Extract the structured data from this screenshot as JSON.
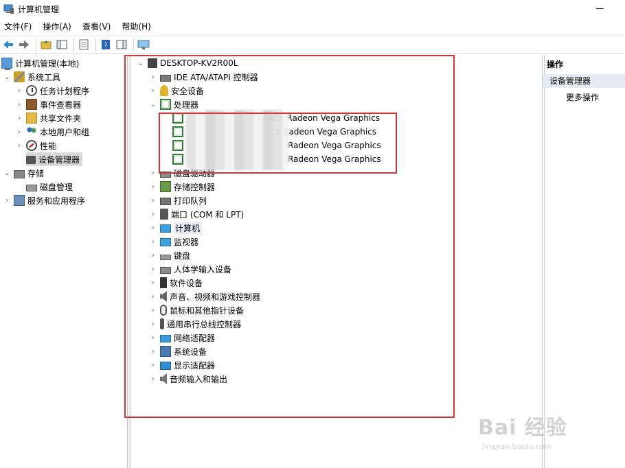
{
  "window": {
    "title": "计算机管理"
  },
  "menu": [
    "文件(F)",
    "操作(A)",
    "查看(V)",
    "帮助(H)"
  ],
  "toolbar": {
    "buttons": [
      "back-icon",
      "forward-icon",
      "up-folder-icon",
      "show-hide-tree-icon",
      "properties-icon",
      "help-icon",
      "action-pane-icon",
      "monitor-icon"
    ]
  },
  "left_tree": [
    {
      "label": "计算机管理(本地)",
      "icon": "computer-management-icon",
      "expander": ""
    },
    {
      "label": "系统工具",
      "icon": "tools-icon",
      "expander": "⌄"
    },
    {
      "label": "任务计划程序",
      "icon": "task-scheduler-icon",
      "expander": "›"
    },
    {
      "label": "事件查看器",
      "icon": "event-viewer-icon",
      "expander": "›"
    },
    {
      "label": "共享文件夹",
      "icon": "shared-folder-icon",
      "expander": "›"
    },
    {
      "label": "本地用户和组",
      "icon": "users-icon",
      "expander": "›"
    },
    {
      "label": "性能",
      "icon": "performance-icon",
      "expander": "›"
    },
    {
      "label": "设备管理器",
      "icon": "device-manager-icon",
      "expander": ""
    },
    {
      "label": "存储",
      "icon": "storage-icon",
      "expander": "⌄"
    },
    {
      "label": "磁盘管理",
      "icon": "disk-icon",
      "expander": ""
    },
    {
      "label": "服务和应用程序",
      "icon": "services-icon",
      "expander": "›"
    }
  ],
  "device_tree": {
    "root": "DESKTOP-KV2R00L",
    "categories": [
      {
        "label": "IDE ATA/ATAPI 控制器",
        "icon": "ide-controller-icon"
      },
      {
        "label": "安全设备",
        "icon": "security-device-icon"
      },
      {
        "label": "处理器",
        "icon": "processor-icon"
      },
      {
        "label": "磁盘驱动器",
        "icon": "disk-drive-icon"
      },
      {
        "label": "存储控制器",
        "icon": "storage-controller-icon"
      },
      {
        "label": "打印队列",
        "icon": "printer-icon"
      },
      {
        "label": "端口 (COM 和 LPT)",
        "icon": "port-icon"
      },
      {
        "label": "计算机",
        "icon": "computer-icon"
      },
      {
        "label": "监视器",
        "icon": "monitor-icon"
      },
      {
        "label": "键盘",
        "icon": "keyboard-icon"
      },
      {
        "label": "人体学输入设备",
        "icon": "hid-icon"
      },
      {
        "label": "软件设备",
        "icon": "software-device-icon"
      },
      {
        "label": "声音、视频和游戏控制器",
        "icon": "sound-icon"
      },
      {
        "label": "鼠标和其他指针设备",
        "icon": "mouse-icon"
      },
      {
        "label": "通用串行总线控制器",
        "icon": "usb-icon"
      },
      {
        "label": "网络适配器",
        "icon": "network-adapter-icon"
      },
      {
        "label": "系统设备",
        "icon": "system-device-icon"
      },
      {
        "label": "显示适配器",
        "icon": "display-adapter-icon"
      },
      {
        "label": "音频输入和输出",
        "icon": "audio-io-icon"
      }
    ],
    "processors": [
      "G with Radeon Vega Graphics",
      "h Radeon Vega Graphics",
      "Radeon Vega Graphics",
      "Radeon Vega Graphics"
    ]
  },
  "actions": {
    "header": "操作",
    "selected": "设备管理器",
    "more": "更多操作"
  },
  "watermark": {
    "main": "Bai 经验",
    "sub": "jingyan.baidu.com"
  },
  "colors": {
    "highlight_box": "#d9333a",
    "selection": "#d9d9d9",
    "action_selected": "#e5ebf2"
  }
}
